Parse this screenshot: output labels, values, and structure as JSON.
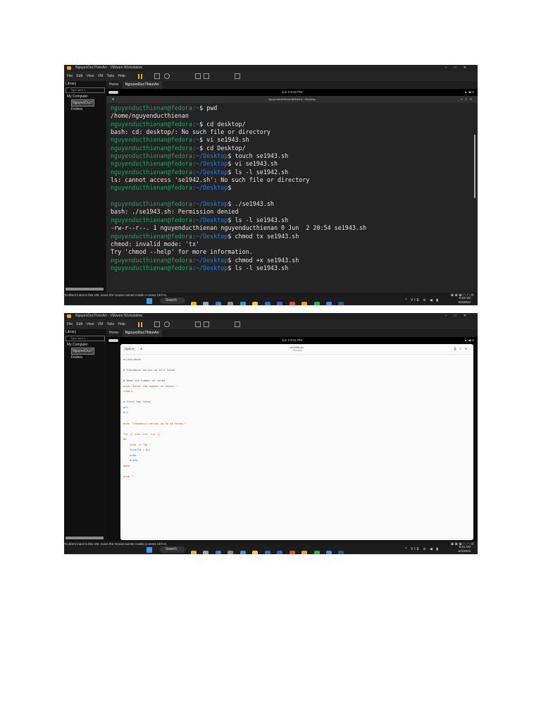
{
  "screenshot1": {
    "window_title": "NguyenDucThienAn - VMware Workstation",
    "menu": [
      "File",
      "Edit",
      "View",
      "VM",
      "Tabs",
      "Help"
    ],
    "library_label": "Library",
    "library_search_placeholder": "Type here t...",
    "tree": {
      "root": "My Computer",
      "vm1": "NguyenDucT",
      "vm2": "Fedora"
    },
    "tabs": {
      "home": "Home",
      "active": "NguyenDucThienAn"
    },
    "gnome_clock": "Jun 2  9:22 PM",
    "terminal_title": "nguyenducthienan@fedora:~/Desktop",
    "terminal_lines": [
      {
        "prompt": "nguyenducthienan@fedora:",
        "dir": "~",
        "cmd": "$ pwd"
      },
      {
        "out": "/home/nguyenducthienan"
      },
      {
        "prompt": "nguyenducthienan@fedora:",
        "dir": "~",
        "cmd": "$ cd desktop/"
      },
      {
        "out": "bash: cd: desktop/: No such file or directory"
      },
      {
        "prompt": "nguyenducthienan@fedora:",
        "dir": "~",
        "cmd": "$ vi se1943.sh"
      },
      {
        "prompt": "nguyenducthienan@fedora:",
        "dir": "~",
        "cmd": "$ cd Desktop/"
      },
      {
        "prompt": "nguyenducthienan@fedora:",
        "dir": "~/Desktop",
        "cmd": "$ touch se1943.sh"
      },
      {
        "prompt": "nguyenducthienan@fedora:",
        "dir": "~/Desktop",
        "cmd": "$ vi se1943.sh"
      },
      {
        "prompt": "nguyenducthienan@fedora:",
        "dir": "~/Desktop",
        "cmd": "$ ls -l se1942.sh"
      },
      {
        "out": "ls: cannot access 'se1942.sh': No such file or directory"
      },
      {
        "prompt": "nguyenducthienan@fedora:",
        "dir": "~/Desktop",
        "cmd": "$"
      },
      {
        "out": ""
      },
      {
        "prompt": "nguyenducthienan@fedora:",
        "dir": "~/Desktop",
        "cmd": "$ ./se1943.sh"
      },
      {
        "out": "bash: ./se1943.sh: Permission denied"
      },
      {
        "prompt": "nguyenducthienan@fedora:",
        "dir": "~/Desktop",
        "cmd": "$ ls -l se1943.sh"
      },
      {
        "out": "-rw-r--r--. 1 nguyenducthienan nguyenducthienan 0 Jun  2 20:54 se1943.sh"
      },
      {
        "prompt": "nguyenducthienan@fedora:",
        "dir": "~/Desktop",
        "cmd": "$ chmod tx se1943.sh"
      },
      {
        "out": "chmod: invalid mode: 'tx'"
      },
      {
        "out": "Try 'chmod --help' for more information."
      },
      {
        "prompt": "nguyenducthienan@fedora:",
        "dir": "~/Desktop",
        "cmd": "$ chmod +x se1943.sh"
      },
      {
        "prompt": "nguyenducthienan@fedora:",
        "dir": "~/Desktop",
        "cmd": "$ ls -l se1943.sh"
      }
    ],
    "status_message": "To direct input to this VM, move the mouse pointer inside or press Ctrl+G.",
    "taskbar": {
      "search": "Search",
      "lang": "VIE",
      "time": "8:23 AM",
      "date": "6/3/2024"
    }
  },
  "screenshot2": {
    "window_title": "NguyenDucThienAn - VMware Workstation",
    "menu": [
      "File",
      "Edit",
      "View",
      "VM",
      "Tabs",
      "Help"
    ],
    "library_label": "Library",
    "library_search_placeholder": "Type here t...",
    "tree": {
      "root": "My Computer",
      "vm1": "NguyenDucT",
      "vm2": "Fedora"
    },
    "tabs": {
      "home": "Home",
      "active": "NguyenDucThienAn"
    },
    "gnome_clock": "Jun 2  9:21 PM",
    "editor": {
      "open_label": "Open ▾",
      "file_name": "se1943.sh",
      "file_path": "~/Desktop",
      "code": [
        {
          "t": "#!/bin/bash",
          "c": "plain"
        },
        {
          "t": "",
          "c": "plain"
        },
        {
          "t": "# Fibonacci series up to n terms",
          "c": "plain"
        },
        {
          "t": "",
          "c": "plain"
        },
        {
          "t": "# Read the number of terms",
          "c": "plain"
        },
        {
          "t": "echo \"Enter the number of terms: \"",
          "c": "echo"
        },
        {
          "t": "read n",
          "c": "kw"
        },
        {
          "t": "",
          "c": "plain"
        },
        {
          "t": "# First two terms",
          "c": "plain"
        },
        {
          "t": "a=1",
          "c": "var"
        },
        {
          "t": "b=1",
          "c": "var"
        },
        {
          "t": "",
          "c": "plain"
        },
        {
          "t": "echo \"Fibonacci series up to $n terms:\"",
          "c": "echo"
        },
        {
          "t": "",
          "c": "plain"
        },
        {
          "t": "for (( i=0; i<n; i++ ))",
          "c": "kw"
        },
        {
          "t": "do",
          "c": "kw"
        },
        {
          "t": "    echo -n \"$a \"",
          "c": "echo"
        },
        {
          "t": "    fn=$((a + b))",
          "c": "var"
        },
        {
          "t": "    a=$b",
          "c": "var"
        },
        {
          "t": "    b=$fn",
          "c": "var"
        },
        {
          "t": "done",
          "c": "kw"
        },
        {
          "t": "",
          "c": "plain"
        },
        {
          "t": "echo \"\"",
          "c": "echo"
        }
      ]
    },
    "status_message": "To direct input to this VM, move the mouse pointer inside or press Ctrl+G.",
    "taskbar": {
      "search": "Search",
      "lang": "VIE",
      "time": "8:21 AM",
      "date": "6/3/2024"
    }
  },
  "colors": {
    "prompt": "#26a269",
    "dir": "#2a7bde",
    "accent": "#e8a030"
  }
}
